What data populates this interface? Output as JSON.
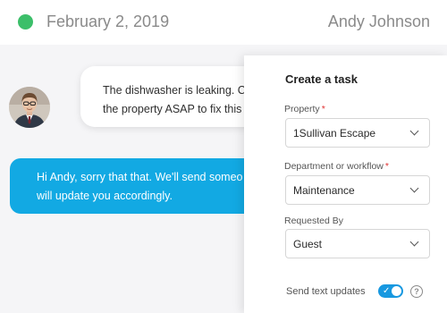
{
  "header": {
    "date": "February 2, 2019",
    "user_name": "Andy Johnson",
    "status_color": "#3cbf6a"
  },
  "chat": {
    "incoming_message": {
      "line1": "The dishwasher is leaking. C",
      "line2": "the property ASAP to fix this"
    },
    "outgoing_message": {
      "line1": "Hi Andy, sorry that that. We'll send someo",
      "line2": "will update you accordingly."
    },
    "outgoing_color": "#12a9e3"
  },
  "task_panel": {
    "title": "Create a task",
    "property": {
      "label": "Property",
      "required_mark": "*",
      "value": "1Sullivan Escape"
    },
    "department": {
      "label": "Department or workflow",
      "required_mark": "*",
      "value": "Maintenance"
    },
    "requested_by": {
      "label": "Requested By",
      "value": "Guest"
    },
    "send_text_updates": {
      "label": "Send text updates",
      "enabled": true,
      "help_glyph": "?"
    }
  }
}
